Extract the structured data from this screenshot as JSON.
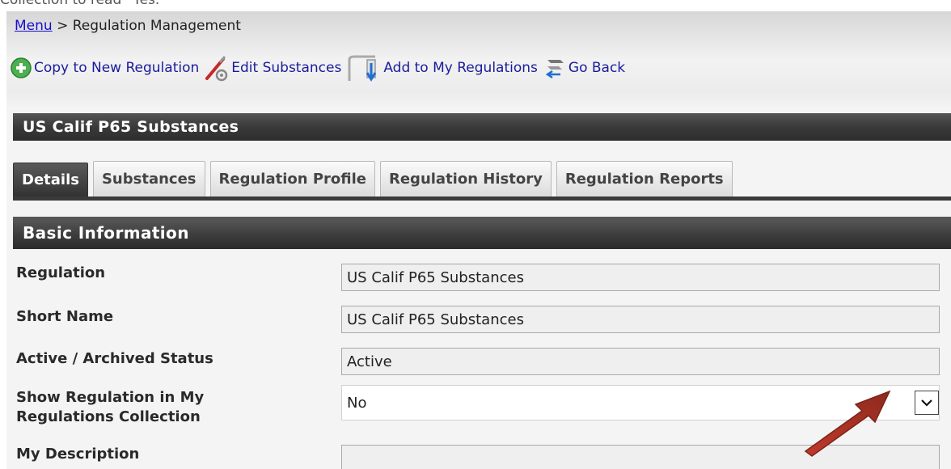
{
  "caption_fragment": "Collection to read “Yes.”",
  "breadcrumb": {
    "menu_link": "Menu",
    "separator": ">",
    "current": "Regulation Management"
  },
  "toolbar": {
    "copy_label": "Copy to New Regulation",
    "edit_label": "Edit Substances",
    "add_label": "Add to My Regulations",
    "back_label": "Go Back"
  },
  "page_title": "US Calif P65 Substances",
  "tabs": [
    {
      "label": "Details",
      "active": true
    },
    {
      "label": "Substances",
      "active": false
    },
    {
      "label": "Regulation Profile",
      "active": false
    },
    {
      "label": "Regulation History",
      "active": false
    },
    {
      "label": "Regulation Reports",
      "active": false
    }
  ],
  "section_title": "Basic Information",
  "fields": {
    "regulation": {
      "label": "Regulation",
      "value": "US Calif P65 Substances"
    },
    "short_name": {
      "label": "Short Name",
      "value": "US Calif P65 Substances"
    },
    "status": {
      "label": "Active / Archived Status",
      "value": "Active"
    },
    "show_in_collection": {
      "label_line1": "Show Regulation in My",
      "label_line2": "Regulations Collection",
      "value": "No"
    },
    "my_description": {
      "label": "My Description",
      "value": ""
    }
  },
  "colors": {
    "link": "#1a0dcc",
    "header_dark": "#333333",
    "annotation_arrow": "#b03a2e"
  }
}
